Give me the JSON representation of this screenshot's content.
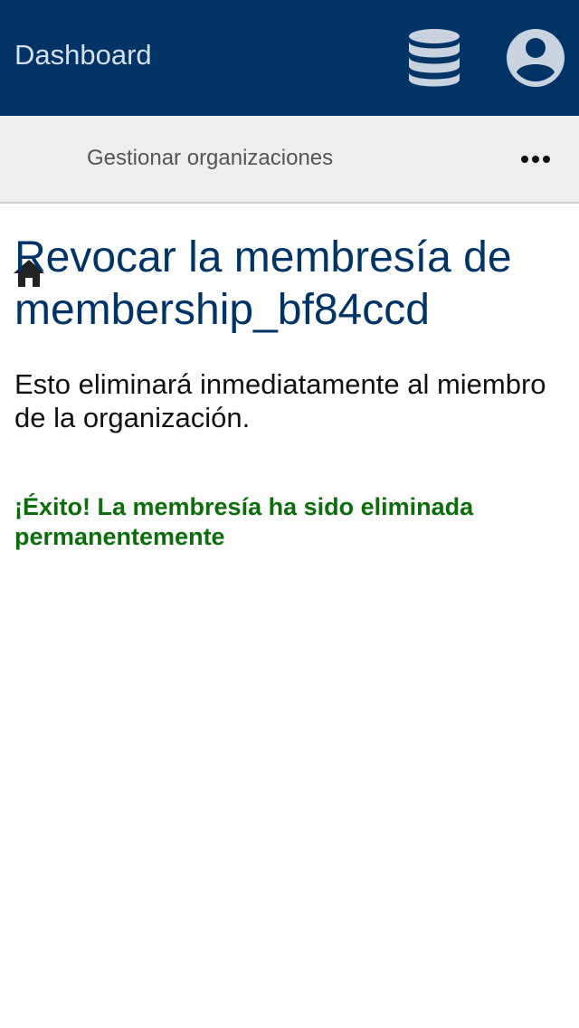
{
  "header": {
    "title": "Dashboard",
    "icons": {
      "database": "database-icon",
      "user": "user-circle-icon"
    }
  },
  "subnav": {
    "home_icon": "home-icon",
    "breadcrumb": "Gestionar organizaciones",
    "more_icon": "more-horizontal-icon"
  },
  "main": {
    "heading": "Revocar la membresía de membership_bf84ccd",
    "description": "Esto eliminará inmediatamente al miembro de la organización.",
    "success_message": "¡Éxito! La membresía ha sido eliminada permanentemente"
  },
  "colors": {
    "header_bg": "#003366",
    "subnav_bg": "#eeeeee",
    "heading": "#003366",
    "success": "#0b6e0b",
    "icon_light": "#c8d3df"
  }
}
